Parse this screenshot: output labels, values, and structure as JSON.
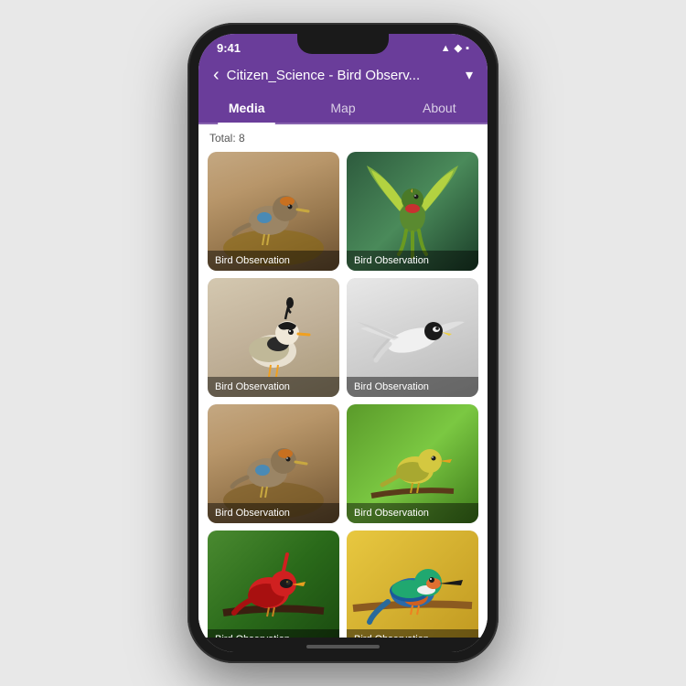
{
  "status": {
    "time": "9:41",
    "icons": "▲ ◆ ▪"
  },
  "header": {
    "back_label": "‹",
    "title": "Citizen_Science - Bird Observ...",
    "dropdown_icon": "▾"
  },
  "tabs": [
    {
      "id": "media",
      "label": "Media",
      "active": true
    },
    {
      "id": "map",
      "label": "Map",
      "active": false
    },
    {
      "id": "about",
      "label": "About",
      "active": false
    }
  ],
  "content": {
    "total_label": "Total: 8",
    "cards": [
      {
        "id": 1,
        "label": "Bird Observation",
        "bg_class": "bird-1"
      },
      {
        "id": 2,
        "label": "Bird Observation",
        "bg_class": "bird-2"
      },
      {
        "id": 3,
        "label": "Bird Observation",
        "bg_class": "bird-3"
      },
      {
        "id": 4,
        "label": "Bird Observation",
        "bg_class": "bird-4"
      },
      {
        "id": 5,
        "label": "Bird Observation",
        "bg_class": "bird-5"
      },
      {
        "id": 6,
        "label": "Bird Observation",
        "bg_class": "bird-6"
      },
      {
        "id": 7,
        "label": "Bird Observation",
        "bg_class": "bird-7"
      },
      {
        "id": 8,
        "label": "Bird Observation",
        "bg_class": "bird-8"
      }
    ]
  },
  "colors": {
    "purple": "#6a3d9a",
    "tab_active": "#ffffff",
    "tab_inactive": "rgba(255,255,255,0.7)"
  }
}
